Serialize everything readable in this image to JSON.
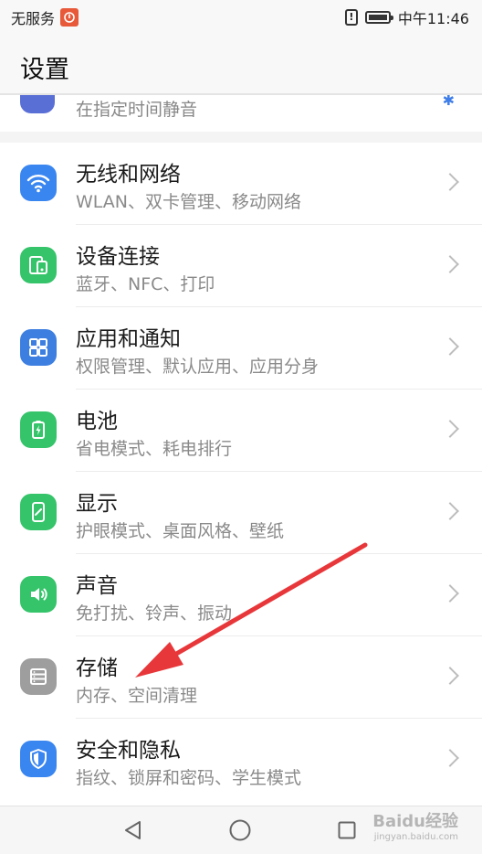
{
  "status_bar": {
    "carrier": "无服务",
    "time": "中午11:46",
    "battery_level": 0.85
  },
  "header": {
    "title": "设置"
  },
  "partial_item": {
    "subtitle": "在指定时间静音"
  },
  "items": [
    {
      "title": "无线和网络",
      "subtitle": "WLAN、双卡管理、移动网络",
      "icon": "wifi-icon",
      "color": "#3a86f0"
    },
    {
      "title": "设备连接",
      "subtitle": "蓝牙、NFC、打印",
      "icon": "device-connection-icon",
      "color": "#35c46a"
    },
    {
      "title": "应用和通知",
      "subtitle": "权限管理、默认应用、应用分身",
      "icon": "apps-icon",
      "color": "#3d7fe0"
    },
    {
      "title": "电池",
      "subtitle": "省电模式、耗电排行",
      "icon": "battery-icon",
      "color": "#35c46a"
    },
    {
      "title": "显示",
      "subtitle": "护眼模式、桌面风格、壁纸",
      "icon": "display-icon",
      "color": "#35c46a"
    },
    {
      "title": "声音",
      "subtitle": "免打扰、铃声、振动",
      "icon": "sound-icon",
      "color": "#35c46a"
    },
    {
      "title": "存储",
      "subtitle": "内存、空间清理",
      "icon": "storage-icon",
      "color": "#9e9e9e"
    },
    {
      "title": "安全和隐私",
      "subtitle": "指纹、锁屏和密码、学生模式",
      "icon": "security-shield-icon",
      "color": "#3a86f0"
    }
  ],
  "watermark": {
    "line1": "Baidu经验",
    "line2": "jingyan.baidu.com"
  },
  "annotation_color": "#e8373a"
}
